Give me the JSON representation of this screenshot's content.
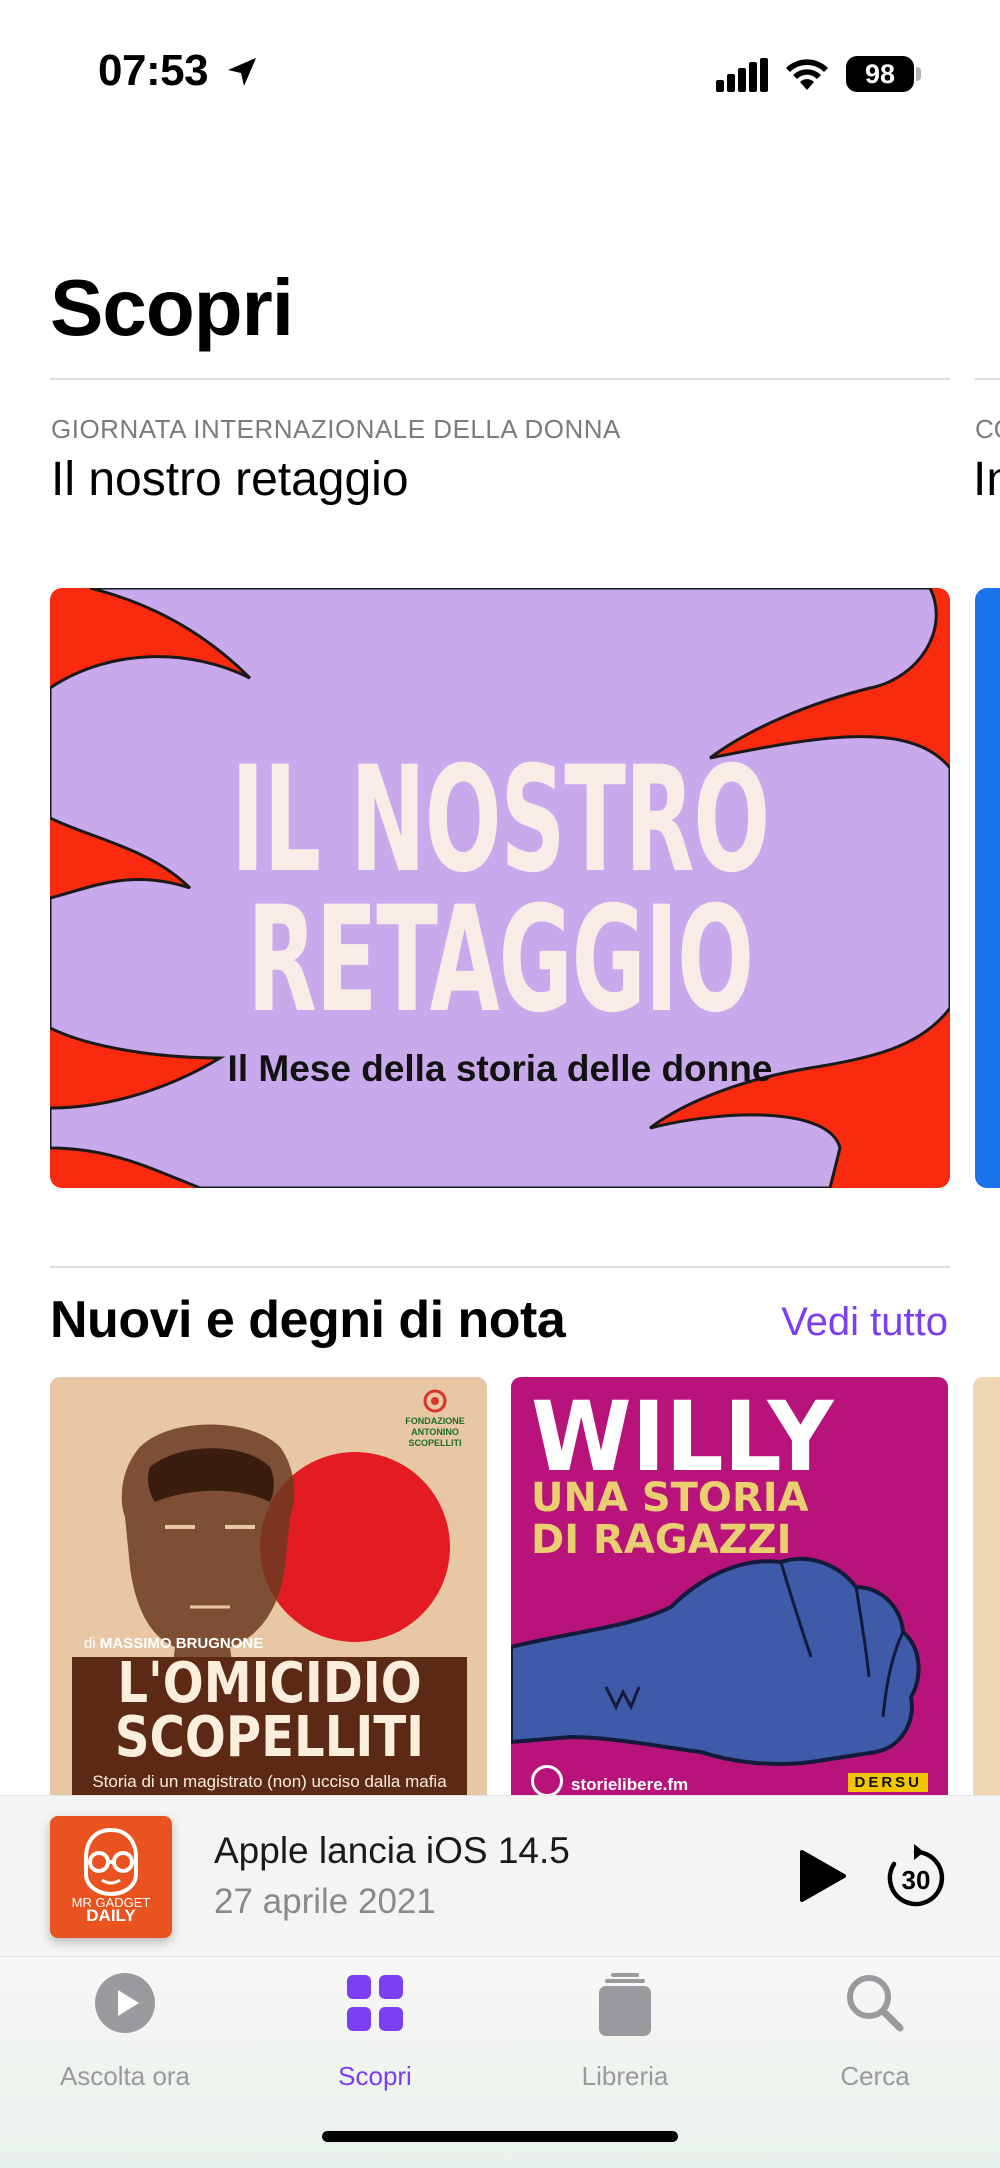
{
  "status_bar": {
    "time": "07:53",
    "battery": "98"
  },
  "page": {
    "title": "Scopri"
  },
  "featured": {
    "eyebrow": "GIORNATA INTERNAZIONALE DELLA DONNA",
    "title": "Il nostro retaggio",
    "peek_eyebrow": "CO",
    "peek_title": "In",
    "banner_headline_line1": "IL NOSTRO",
    "banner_headline_line2": "RETAGGIO",
    "banner_subtitle": "Il Mese della storia delle donne"
  },
  "section": {
    "title": "Nuovi e degni di nota",
    "see_all": "Vedi tutto",
    "cards": [
      {
        "logo_line1": "FONDAZIONE",
        "logo_line2": "ANTONINO",
        "logo_line3": "SCOPELLITI",
        "author_prefix": "di",
        "author": "MASSIMO BRUGNONE",
        "title_line1": "L'OMICIDIO",
        "title_line2": "SCOPELLITI",
        "subtitle": "Storia di un magistrato (non) ucciso dalla mafia"
      },
      {
        "title": "WILLY",
        "subtitle_line1": "UNA STORIA",
        "subtitle_line2": "DI RAGAZZI",
        "footer": "storielibere.fm",
        "brand": "DERSU"
      }
    ]
  },
  "mini_player": {
    "art_line1": "MR GADGET",
    "art_line2": "DAILY",
    "title": "Apple lancia iOS 14.5",
    "date": "27 aprile 2021",
    "skip_seconds": "30"
  },
  "tabs": [
    {
      "label": "Ascolta ora",
      "icon": "play-circle-icon",
      "active": false
    },
    {
      "label": "Scopri",
      "icon": "grid-icon",
      "active": true
    },
    {
      "label": "Libreria",
      "icon": "library-stack-icon",
      "active": false
    },
    {
      "label": "Cerca",
      "icon": "search-icon",
      "active": false
    }
  ],
  "colors": {
    "accent": "#7b3ef0",
    "banner_red": "#fa2a0e",
    "banner_lilac": "#c8a9ec",
    "card2_magenta": "#b8137a",
    "mini_player_art": "#e8531f"
  }
}
